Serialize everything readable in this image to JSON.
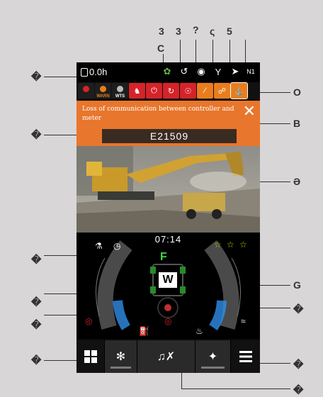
{
  "callouts": {
    "top": [
      "3",
      "3",
      "?",
      "ς",
      "5"
    ],
    "top_under": "C",
    "right": [
      "O",
      "B",
      "Ə",
      "G"
    ],
    "unknown_marker": "�"
  },
  "status": {
    "hour_meter": "0.0h",
    "gear_label": "N1"
  },
  "warnings": {
    "warn_label": "WARN",
    "wts_label": "WTS"
  },
  "alert": {
    "message": "Loss of communication between controller and meter",
    "code": "E21509"
  },
  "gauges": {
    "time": "07:14",
    "gear": "F",
    "mode": "W"
  },
  "colors": {
    "alert_bg": "#e8762d",
    "warn_red": "#d5232a",
    "warn_orange": "#e97d1e",
    "gear_green": "#43d34b",
    "gauge_blue": "#2f8fe8",
    "screen_bg": "#0a0a0a"
  }
}
